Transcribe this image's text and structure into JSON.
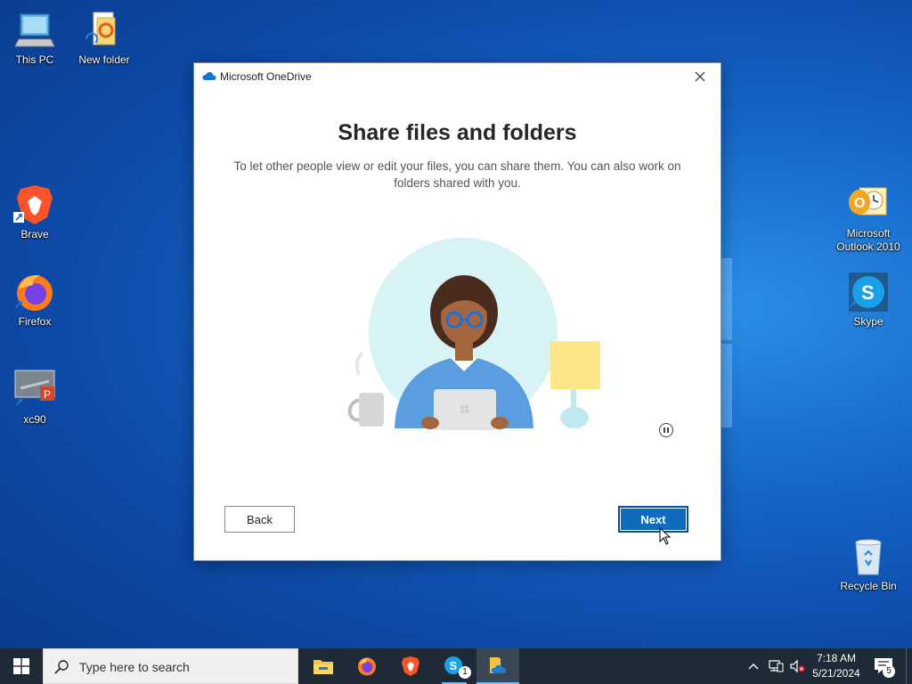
{
  "desktop": {
    "icons": [
      {
        "label": "This PC"
      },
      {
        "label": "New folder"
      },
      {
        "label": "Brave"
      },
      {
        "label": "Firefox"
      },
      {
        "label": "xc90"
      },
      {
        "label": "Microsoft Outlook 2010"
      },
      {
        "label": "Skype"
      },
      {
        "label": "Recycle Bin"
      }
    ]
  },
  "dialog": {
    "title": "Microsoft OneDrive",
    "heading": "Share files and folders",
    "description": "To let other people view or edit your files, you can share them. You can also work on folders shared with you.",
    "back_label": "Back",
    "next_label": "Next"
  },
  "taskbar": {
    "search_placeholder": "Type here to search",
    "skype_badge": "1",
    "time": "7:18 AM",
    "date": "5/21/2024",
    "notification_count": "5"
  },
  "colors": {
    "accent": "#0f6cbd",
    "taskbar": "#1e2a36",
    "onedrive": "#0f78d4"
  }
}
